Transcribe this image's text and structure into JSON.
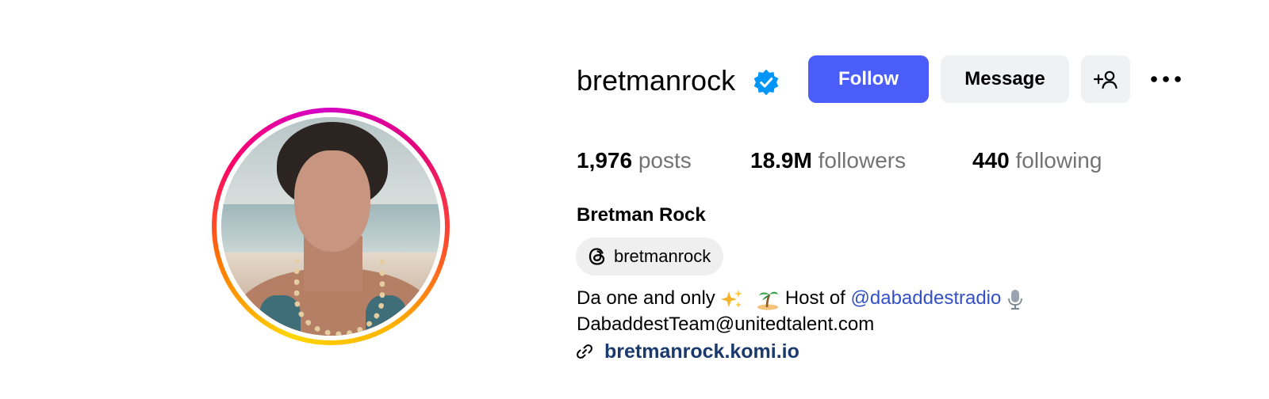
{
  "profile": {
    "username": "bretmanrock",
    "verified": true,
    "full_name": "Bretman Rock",
    "avatar_icon": "profile-photo",
    "story_ring_colors": [
      "#ffd600",
      "#ff7a00",
      "#ff0069",
      "#d300c5"
    ]
  },
  "actions": {
    "follow_label": "Follow",
    "message_label": "Message",
    "suggest_icon": "add-person-icon",
    "more_icon": "more-options-icon"
  },
  "stats": [
    {
      "value": "1,976",
      "label": "posts"
    },
    {
      "value": "18.9M",
      "label": "followers"
    },
    {
      "value": "440",
      "label": "following"
    }
  ],
  "threads": {
    "icon": "threads-icon",
    "handle": "bretmanrock"
  },
  "bio": {
    "line1_text": "Da one and only",
    "line1_emoji_1": "sparkles-emoji",
    "line1_emoji_2": "desert-island-emoji",
    "line1_host": "Host of",
    "mention": "@dabaddestradio",
    "mention_emoji": "microphone-emoji",
    "line2": "DabaddestTeam@unitedtalent.com",
    "link_icon": "link-icon",
    "link": "bretmanrock.komi.io"
  },
  "colors": {
    "accent": "#4a5df9",
    "secondary_button": "#eff2f5",
    "mention": "#3450c9",
    "muted": "#737373",
    "verified": "#0095f6"
  }
}
